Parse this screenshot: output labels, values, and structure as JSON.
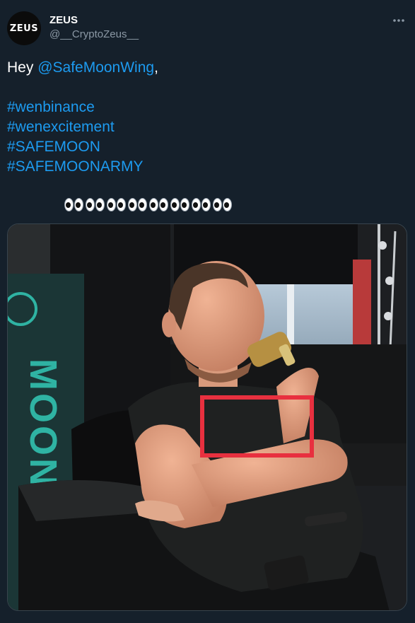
{
  "author": {
    "avatar_text": "ZEUS",
    "name": "ZEUS",
    "handle": "@__CryptoZeus__"
  },
  "tweet": {
    "greeting_prefix": "Hey ",
    "mention": "@SafeMoonWing",
    "greeting_suffix": ",",
    "hashtags": [
      "#wenbinance",
      "#wenexcitement",
      "#SAFEMOON",
      "#SAFEMOONARMY"
    ],
    "eyes_emoji_count": 8
  },
  "media": {
    "banner_text": "MOON",
    "highlight_color": "#e8303f"
  },
  "colors": {
    "background": "#15202b",
    "link": "#1d9bf0",
    "secondary_text": "#8b98a5"
  }
}
